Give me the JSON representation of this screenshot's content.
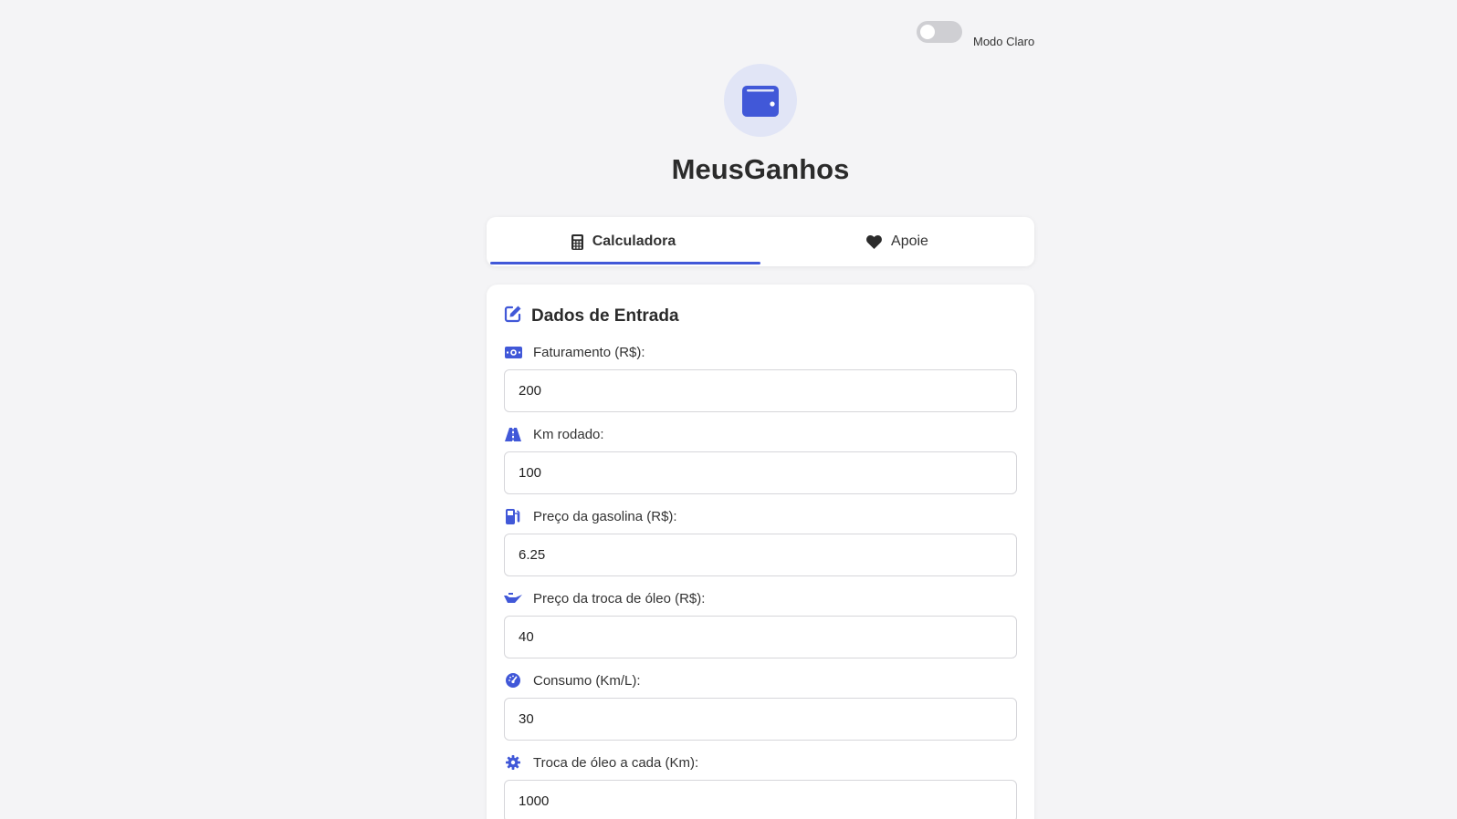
{
  "theme": {
    "label": "Modo Claro",
    "dark_enabled": false
  },
  "header": {
    "title": "MeusGanhos",
    "logo_icon": "wallet-icon"
  },
  "tabs": [
    {
      "label": "Calculadora",
      "icon": "calculator-icon",
      "active": true
    },
    {
      "label": "Apoie",
      "icon": "heart-icon",
      "active": false
    }
  ],
  "form": {
    "title": "Dados de Entrada",
    "title_icon": "edit-icon",
    "fields": [
      {
        "label": "Faturamento (R$):",
        "value": "200",
        "icon": "money-bill-icon"
      },
      {
        "label": "Km rodado:",
        "value": "100",
        "icon": "road-icon"
      },
      {
        "label": "Preço da gasolina (R$):",
        "value": "6.25",
        "icon": "gas-pump-icon"
      },
      {
        "label": "Preço da troca de óleo (R$):",
        "value": "40",
        "icon": "oil-can-icon"
      },
      {
        "label": "Consumo (Km/L):",
        "value": "30",
        "icon": "gauge-icon"
      },
      {
        "label": "Troca de óleo a cada (Km):",
        "value": "1000",
        "icon": "gear-icon"
      }
    ]
  },
  "colors": {
    "accent": "#4158d8",
    "background": "#f4f4f6",
    "card": "#ffffff",
    "logo_circle": "#e1e5f6"
  }
}
